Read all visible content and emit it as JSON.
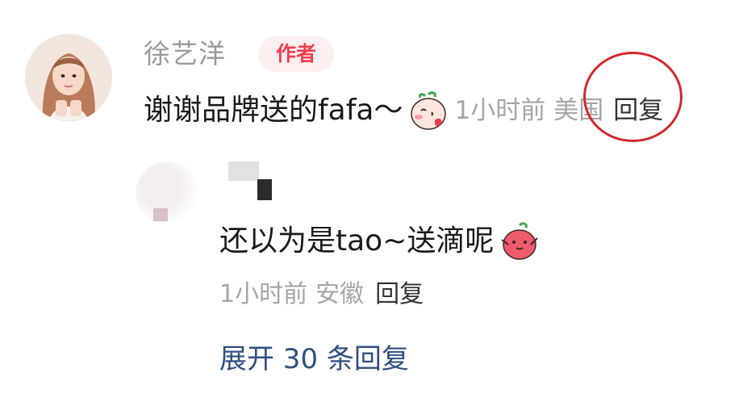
{
  "comment": {
    "author_name": "徐艺洋",
    "author_badge": "作者",
    "text": "谢谢品牌送的fafa～",
    "emoji_icon": "blushing-peach-icon",
    "time": "1小时前",
    "location": "美国",
    "reply_label": "回复"
  },
  "reply": {
    "text": "还以为是tao~送滴呢",
    "emoji_icon": "peach-hug-icon",
    "time": "1小时前",
    "location": "安徽",
    "reply_label": "回复"
  },
  "expand_label": "展开 30 条回复",
  "colors": {
    "badge_text": "#ee3f4d",
    "badge_bg": "#fdeef0",
    "meta": "#a6a6a6",
    "link": "#2f4f7f",
    "annotation": "#d3272d"
  }
}
